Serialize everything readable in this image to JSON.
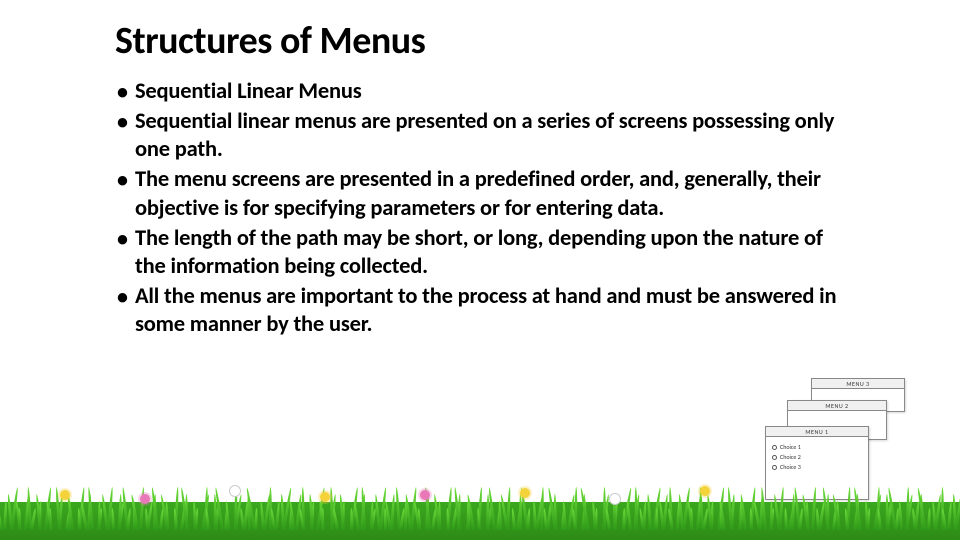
{
  "title": "Structures of Menus",
  "bullets": [
    "Sequential Linear Menus",
    "Sequential linear menus are presented on a series of screens possessing only one path.",
    "The menu screens are presented in a predefined order, and, generally, their objective is for specifying parameters or for entering data.",
    "The length of the path may be short, or long, depending upon the nature of the information being collected.",
    "All the menus are important to the process at hand and must be answered in some manner by the user."
  ],
  "dialogs": {
    "d3": {
      "title": "MENU 3"
    },
    "d2": {
      "title": "MENU 2"
    },
    "d1": {
      "title": "MENU 1",
      "options": [
        "Choice 1",
        "Choice 2",
        "Choice 3"
      ]
    }
  }
}
